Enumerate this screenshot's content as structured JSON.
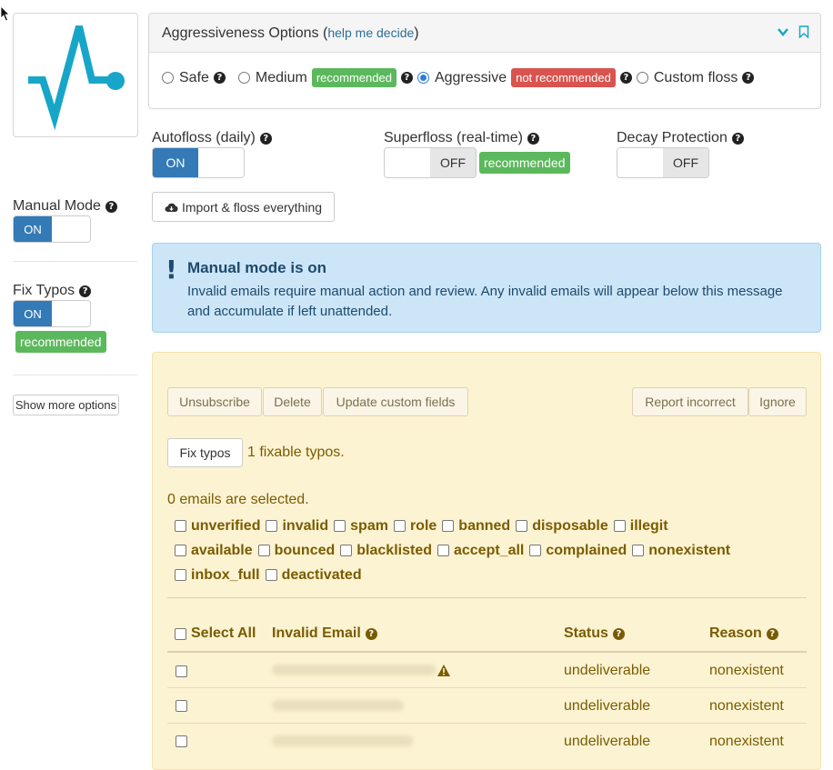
{
  "aggressiveness": {
    "title": "Aggressiveness Options",
    "help_paren_open": "(",
    "help_link": "help me decide",
    "help_paren_close": ")",
    "options": [
      {
        "label": "Safe",
        "selected": false
      },
      {
        "label": "Medium",
        "badge": "recommended",
        "selected": false
      },
      {
        "label": "Aggressive",
        "badge": "not recommended",
        "selected": true
      },
      {
        "label": "Custom floss",
        "selected": false
      }
    ]
  },
  "autofloss": {
    "label": "Autofloss (daily)",
    "state": "ON"
  },
  "superfloss": {
    "label": "Superfloss (real-time)",
    "state": "OFF",
    "badge": "recommended"
  },
  "decay": {
    "label": "Decay Protection",
    "state": "OFF"
  },
  "manual_mode": {
    "label": "Manual Mode",
    "state": "ON"
  },
  "fix_typos_setting": {
    "label": "Fix Typos",
    "state": "ON",
    "badge": "recommended"
  },
  "show_more": "Show more options",
  "import_button": "Import & floss everything",
  "alert": {
    "title": "Manual mode is on",
    "body": "Invalid emails require manual action and review. Any invalid emails will appear below this message and accumulate if left unattended."
  },
  "actions": {
    "unsubscribe": "Unsubscribe",
    "delete": "Delete",
    "update_custom_fields": "Update custom fields",
    "report_incorrect": "Report incorrect",
    "ignore": "Ignore",
    "fix_typos": "Fix typos",
    "fixable_text": "1 fixable typos."
  },
  "selected_text": "0 emails are selected.",
  "filters": [
    "unverified",
    "invalid",
    "spam",
    "role",
    "banned",
    "disposable",
    "illegit",
    "available",
    "bounced",
    "blacklisted",
    "accept_all",
    "complained",
    "nonexistent",
    "inbox_full",
    "deactivated"
  ],
  "table": {
    "headers": {
      "select_all": "Select All",
      "email": "Invalid Email",
      "status": "Status",
      "reason": "Reason"
    },
    "rows": [
      {
        "status": "undeliverable",
        "reason": "nonexistent",
        "warning": true
      },
      {
        "status": "undeliverable",
        "reason": "nonexistent",
        "warning": false
      },
      {
        "status": "undeliverable",
        "reason": "nonexistent",
        "warning": false
      }
    ]
  },
  "colors": {
    "primary": "#337ab7",
    "success": "#5cb85c",
    "danger": "#d9534f",
    "alert_bg": "#cce5f7",
    "section_bg": "#fcf3d3"
  }
}
